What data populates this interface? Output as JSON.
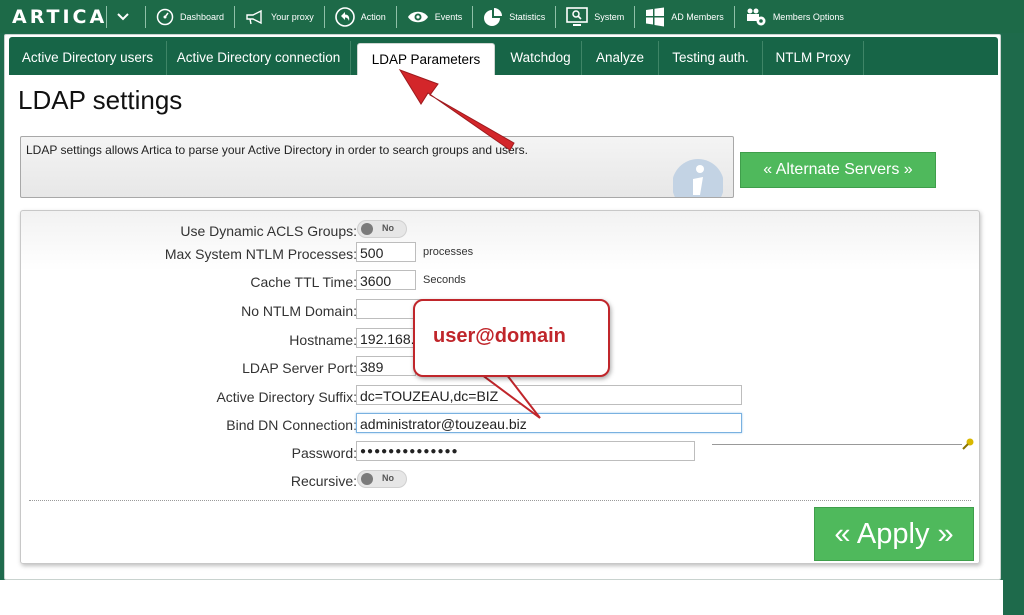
{
  "app": {
    "logo": "ARTICA"
  },
  "nav": [
    {
      "label": "Dashboard",
      "icon": "dashboard-icon"
    },
    {
      "label": "Your proxy",
      "icon": "megaphone-icon"
    },
    {
      "label": "Action",
      "icon": "back-arrow-icon"
    },
    {
      "label": "Events",
      "icon": "eye-icon"
    },
    {
      "label": "Statistics",
      "icon": "pie-chart-icon"
    },
    {
      "label": "System",
      "icon": "monitor-search-icon"
    },
    {
      "label": "AD Members",
      "icon": "windows-icon"
    },
    {
      "label": "Members Options",
      "icon": "users-gear-icon"
    }
  ],
  "tabs": [
    {
      "label": "Active Directory users"
    },
    {
      "label": "Active Directory connection"
    },
    {
      "label": "LDAP Parameters",
      "active": true
    },
    {
      "label": "Watchdog"
    },
    {
      "label": "Analyze"
    },
    {
      "label": "Testing auth."
    },
    {
      "label": "NTLM Proxy"
    }
  ],
  "page": {
    "title": "LDAP settings",
    "explain": "LDAP settings allows Artica to parse your Active Directory in order to search groups and users.",
    "alternate_button": "« Alternate Servers »",
    "apply_button": "« Apply »"
  },
  "form": {
    "dynamic_acls": {
      "label": "Use Dynamic ACLS Groups:",
      "toggle": "No"
    },
    "max_ntlm": {
      "label": "Max System NTLM Processes:",
      "value": "500",
      "unit": "processes"
    },
    "cache_ttl": {
      "label": "Cache TTL Time:",
      "value": "3600",
      "unit": "Seconds"
    },
    "no_ntlm_domain": {
      "label": "No NTLM Domain:",
      "value": ""
    },
    "hostname": {
      "label": "Hostname:",
      "value": "192.168."
    },
    "ldap_port": {
      "label": "LDAP Server Port:",
      "value": "389"
    },
    "ad_suffix": {
      "label": "Active Directory Suffix:",
      "value": "dc=TOUZEAU,dc=BIZ"
    },
    "bind_dn": {
      "label": "Bind DN Connection:",
      "value": "administrator@touzeau.biz"
    },
    "password": {
      "label": "Password:",
      "value": "●●●●●●●●●●●●●●"
    },
    "recursive": {
      "label": "Recursive:",
      "toggle": "No"
    }
  },
  "annotation": {
    "text": "user@domain"
  },
  "colors": {
    "brand_green": "#1d6a48",
    "button_green": "#4fb95c",
    "annotation_red": "#c0262b"
  }
}
